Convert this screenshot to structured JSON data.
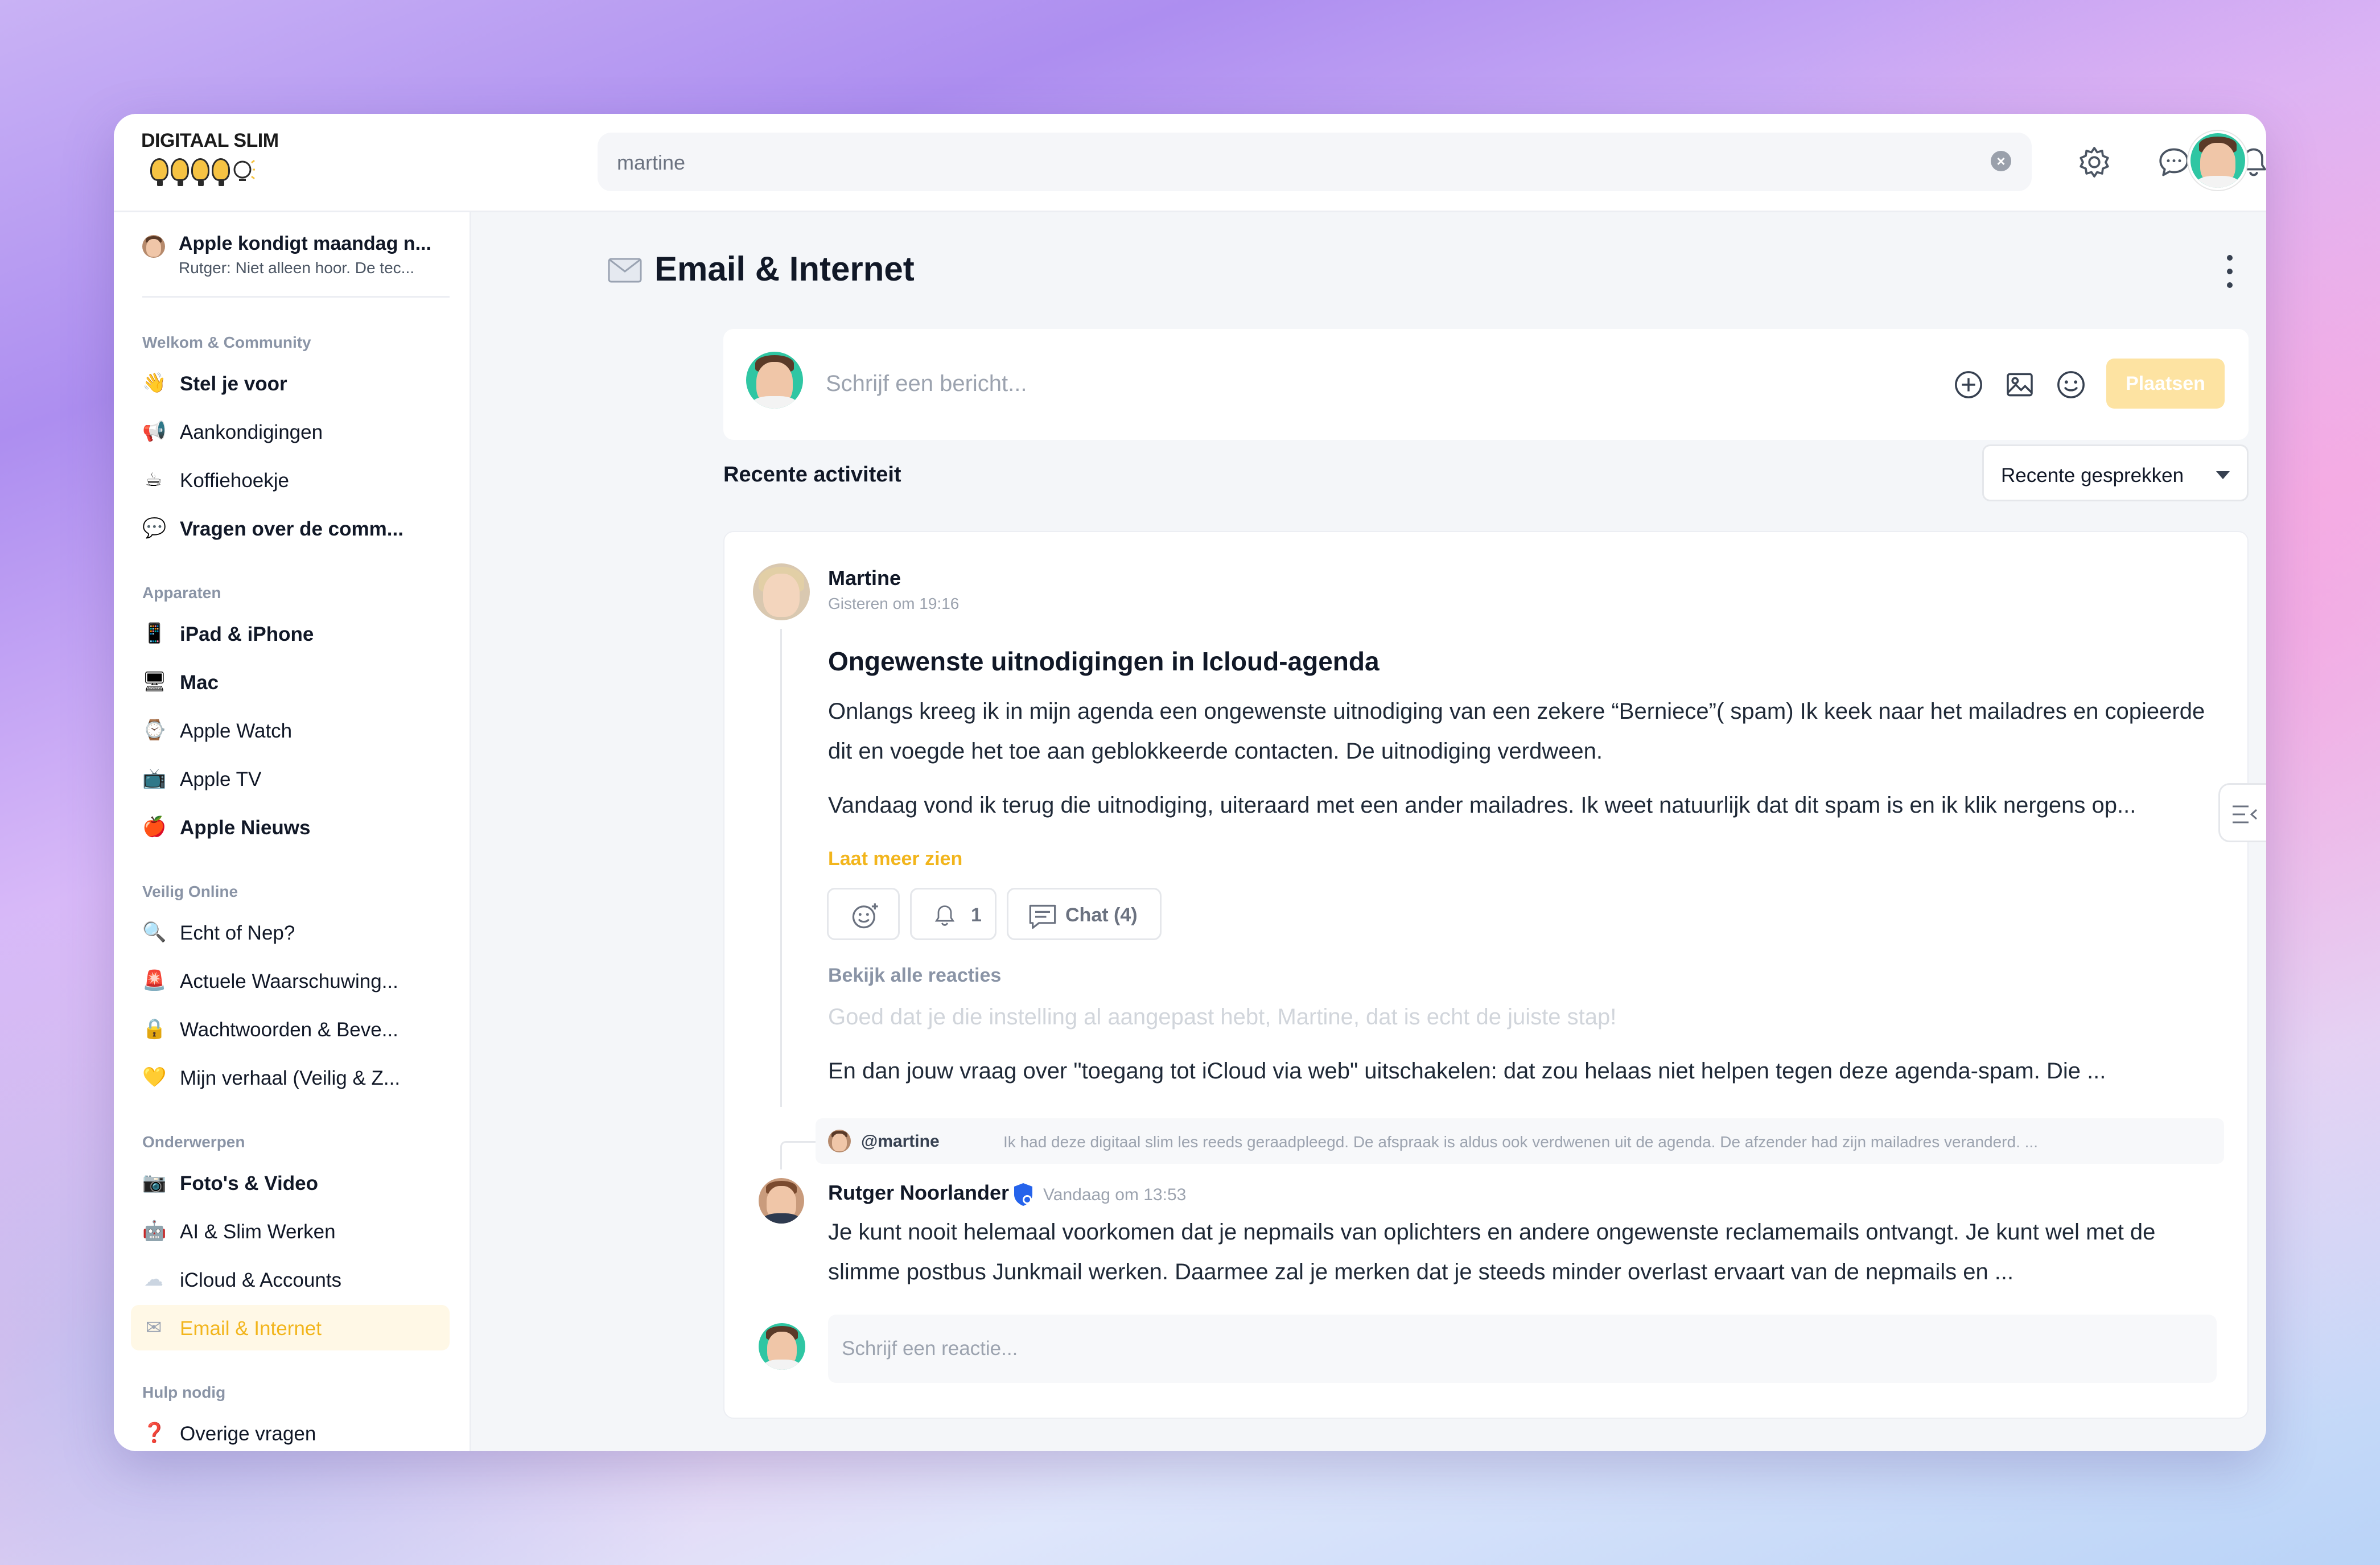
{
  "app": {
    "logo_text": "DIGITAAL SLIM"
  },
  "topbar": {
    "search_value": "martine",
    "icons": [
      "gear-icon",
      "chat-icon",
      "bell-icon"
    ],
    "notification_dot_color": "#ef4444"
  },
  "sidebar": {
    "pinned": {
      "title": "Apple kondigt maandag n...",
      "subtitle": "Rutger: Niet alleen hoor. De tec..."
    },
    "sections": [
      {
        "heading": "Welkom & Community",
        "items": [
          {
            "icon": "👋",
            "label": "Stel je voor",
            "bold": true
          },
          {
            "icon": "📢",
            "label": "Aankondigingen",
            "bold": false
          },
          {
            "icon": "☕",
            "label": "Koffiehoekje",
            "bold": false
          },
          {
            "icon": "💬",
            "label": "Vragen over de comm...",
            "bold": true
          }
        ]
      },
      {
        "heading": "Apparaten",
        "items": [
          {
            "icon": "📱",
            "label": "iPad & iPhone",
            "bold": true
          },
          {
            "icon": "🖥",
            "label": "Mac",
            "bold": true
          },
          {
            "icon": "⌚",
            "label": "Apple Watch",
            "bold": false
          },
          {
            "icon": "📺",
            "label": "Apple TV",
            "bold": false
          },
          {
            "icon": "🍎",
            "label": "Apple Nieuws",
            "bold": true
          }
        ]
      },
      {
        "heading": "Veilig Online",
        "items": [
          {
            "icon": "🔍",
            "label": "Echt of Nep?",
            "bold": false
          },
          {
            "icon": "🚨",
            "label": "Actuele Waarschuwing...",
            "bold": false
          },
          {
            "icon": "🔒",
            "label": "Wachtwoorden & Beve...",
            "bold": false
          },
          {
            "icon": "💛",
            "label": "Mijn verhaal (Veilig & Z...",
            "bold": false
          }
        ]
      },
      {
        "heading": "Onderwerpen",
        "items": [
          {
            "icon": "📷",
            "label": "Foto's & Video",
            "bold": true
          },
          {
            "icon": "🤖",
            "label": "AI & Slim Werken",
            "bold": false
          },
          {
            "icon": "☁",
            "label": "iCloud & Accounts",
            "bold": false
          },
          {
            "icon": "✉",
            "label": "Email & Internet",
            "bold": false,
            "active": true
          }
        ]
      },
      {
        "heading": "Hulp nodig",
        "items": [
          {
            "icon": "❓",
            "label": "Overige vragen",
            "bold": false
          }
        ]
      }
    ]
  },
  "main": {
    "title": "Email & Internet",
    "composer": {
      "placeholder": "Schrijf een bericht...",
      "post_label": "Plaatsen"
    },
    "recent_heading": "Recente activiteit",
    "sort_value": "Recente gesprekken",
    "post": {
      "author": "Martine",
      "time": "Gisteren om 19:16",
      "title": "Ongewenste uitnodigingen in Icloud-agenda",
      "body1": "Onlangs kreeg ik in mijn agenda een ongewenste uitnodiging van een zekere “Berniece”( spam)   Ik keek naar het mailadres en copieerde dit en voegde het toe aan geblokkeerde contacten. De uitnodiging verdween.",
      "body2": "Vandaag vond ik terug die uitnodiging, uiteraard met een ander mailadres. Ik weet natuurlijk dat dit spam is en ik klik nergens op...",
      "more_label": "Laat meer zien",
      "bell_count": "1",
      "chat_label": "Chat (4)",
      "see_all": "Bekijk alle reacties",
      "faded_reply": "Goed dat je die instelling al aangepast hebt, Martine, dat is echt de juiste stap!",
      "reply_snippet": "En dan jouw vraag over \"toegang tot iCloud via web\" uitschakelen: dat zou helaas niet helpen tegen deze agenda-spam. Die ..."
    },
    "quote": {
      "mention": "@martine",
      "text": "Ik had deze digitaal slim les reeds geraadpleegd. De afspraak is aldus ook verdwenen uit de agenda. De afzender had zijn mailadres veranderd. ..."
    },
    "reply": {
      "author": "Rutger Noorlander",
      "time": "Vandaag om 13:53",
      "body": "Je kunt nooit  helemaal voorkomen dat je nepmails van oplichters en andere ongewenste reclamemails ontvangt. Je kunt wel met de slimme postbus Junkmail werken. Daarmee zal je merken dat je steeds minder overlast ervaart van de nepmails en ..."
    },
    "reply_composer": {
      "placeholder": "Schrijf een reactie..."
    }
  },
  "colors": {
    "accent": "#f2b51c",
    "avatar_bg": "#2fc6a3",
    "badge": "#2563eb"
  }
}
